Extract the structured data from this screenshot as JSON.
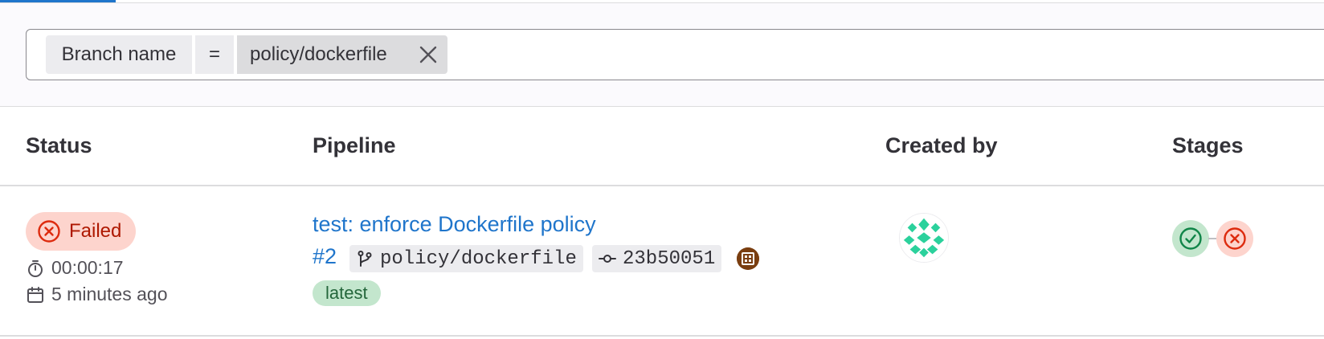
{
  "filter": {
    "token_name": "Branch name",
    "token_operator": "=",
    "token_value": "policy/dockerfile"
  },
  "table": {
    "headers": {
      "status": "Status",
      "pipeline": "Pipeline",
      "created_by": "Created by",
      "stages": "Stages"
    },
    "rows": [
      {
        "status": "Failed",
        "duration": "00:00:17",
        "finished": "5 minutes ago",
        "title": "test: enforce Dockerfile policy",
        "pipeline_id": "#2",
        "branch": "policy/dockerfile",
        "commit": "23b50051",
        "tag": "latest",
        "stages": [
          {
            "status": "success",
            "icon": "check-circle-icon"
          },
          {
            "status": "failed",
            "icon": "x-circle-icon"
          }
        ]
      }
    ]
  },
  "colors": {
    "link": "#1f75cb",
    "failed_bg": "#fdd4cd",
    "failed_text": "#ae1800",
    "success_bg": "#c3e6cd",
    "success_text": "#24663b"
  }
}
